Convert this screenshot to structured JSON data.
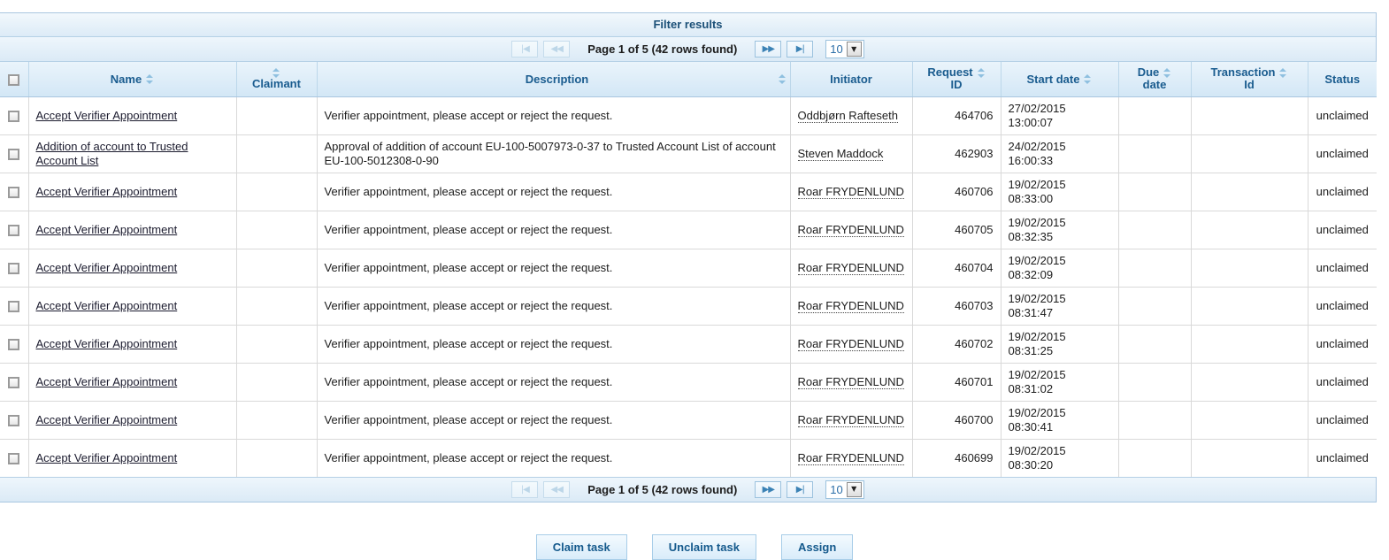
{
  "panel": {
    "title": "Filter results"
  },
  "pager": {
    "first_icon": "⏮",
    "prev_icon": "◀◀",
    "next_icon": "▶▶",
    "last_icon": "▶|",
    "first_label": "|◀",
    "label": "Page 1 of 5 (42 rows found)",
    "page_size": "10",
    "select_arrow": "▼"
  },
  "columns": [
    {
      "key": "checkbox",
      "label": "",
      "sortable": false
    },
    {
      "key": "name",
      "label": "Name",
      "sortable": true
    },
    {
      "key": "claimant",
      "label": "Claimant",
      "sortable": true
    },
    {
      "key": "description",
      "label": "Description",
      "sortable": true
    },
    {
      "key": "initiator",
      "label": "Initiator",
      "sortable": false
    },
    {
      "key": "request_id",
      "label": "Request ID",
      "sortable": true
    },
    {
      "key": "start_date",
      "label": "Start date",
      "sortable": true
    },
    {
      "key": "due_date",
      "label": "Due date",
      "sortable": true
    },
    {
      "key": "transaction_id",
      "label": "Transaction Id",
      "sortable": true
    },
    {
      "key": "status",
      "label": "Status",
      "sortable": false
    }
  ],
  "rows": [
    {
      "name": "Accept Verifier Appointment",
      "claimant": "",
      "description": "Verifier appointment, please accept or reject the request.",
      "initiator": "Oddbjørn Rafteseth",
      "request_id": "464706",
      "start_date": "27/02/2015 13:00:07",
      "due_date": "",
      "transaction_id": "",
      "status": "unclaimed"
    },
    {
      "name": "Addition of account to Trusted Account List",
      "claimant": "",
      "description": "Approval of addition of account EU-100-5007973-0-37 to Trusted Account List of account EU-100-5012308-0-90",
      "initiator": "Steven Maddock",
      "request_id": "462903",
      "start_date": "24/02/2015 16:00:33",
      "due_date": "",
      "transaction_id": "",
      "status": "unclaimed"
    },
    {
      "name": "Accept Verifier Appointment",
      "claimant": "",
      "description": "Verifier appointment, please accept or reject the request.",
      "initiator": "Roar FRYDENLUND",
      "request_id": "460706",
      "start_date": "19/02/2015 08:33:00",
      "due_date": "",
      "transaction_id": "",
      "status": "unclaimed"
    },
    {
      "name": "Accept Verifier Appointment",
      "claimant": "",
      "description": "Verifier appointment, please accept or reject the request.",
      "initiator": "Roar FRYDENLUND",
      "request_id": "460705",
      "start_date": "19/02/2015 08:32:35",
      "due_date": "",
      "transaction_id": "",
      "status": "unclaimed"
    },
    {
      "name": "Accept Verifier Appointment",
      "claimant": "",
      "description": "Verifier appointment, please accept or reject the request.",
      "initiator": "Roar FRYDENLUND",
      "request_id": "460704",
      "start_date": "19/02/2015 08:32:09",
      "due_date": "",
      "transaction_id": "",
      "status": "unclaimed"
    },
    {
      "name": "Accept Verifier Appointment",
      "claimant": "",
      "description": "Verifier appointment, please accept or reject the request.",
      "initiator": "Roar FRYDENLUND",
      "request_id": "460703",
      "start_date": "19/02/2015 08:31:47",
      "due_date": "",
      "transaction_id": "",
      "status": "unclaimed"
    },
    {
      "name": "Accept Verifier Appointment",
      "claimant": "",
      "description": "Verifier appointment, please accept or reject the request.",
      "initiator": "Roar FRYDENLUND",
      "request_id": "460702",
      "start_date": "19/02/2015 08:31:25",
      "due_date": "",
      "transaction_id": "",
      "status": "unclaimed"
    },
    {
      "name": "Accept Verifier Appointment",
      "claimant": "",
      "description": "Verifier appointment, please accept or reject the request.",
      "initiator": "Roar FRYDENLUND",
      "request_id": "460701",
      "start_date": "19/02/2015 08:31:02",
      "due_date": "",
      "transaction_id": "",
      "status": "unclaimed"
    },
    {
      "name": "Accept Verifier Appointment",
      "claimant": "",
      "description": "Verifier appointment, please accept or reject the request.",
      "initiator": "Roar FRYDENLUND",
      "request_id": "460700",
      "start_date": "19/02/2015 08:30:41",
      "due_date": "",
      "transaction_id": "",
      "status": "unclaimed"
    },
    {
      "name": "Accept Verifier Appointment",
      "claimant": "",
      "description": "Verifier appointment, please accept or reject the request.",
      "initiator": "Roar FRYDENLUND",
      "request_id": "460699",
      "start_date": "19/02/2015 08:30:20",
      "due_date": "",
      "transaction_id": "",
      "status": "unclaimed"
    }
  ],
  "actions": {
    "claim": "Claim task",
    "unclaim": "Unclaim task",
    "assign": "Assign"
  },
  "colors": {
    "header_text": "#1a5c8f",
    "panel_border": "#a9c6e0",
    "header_gradient_top": "#eaf4fb",
    "header_gradient_bottom": "#d3e7f6",
    "button_text": "#14598c",
    "link_text": "#1b1b2e"
  }
}
